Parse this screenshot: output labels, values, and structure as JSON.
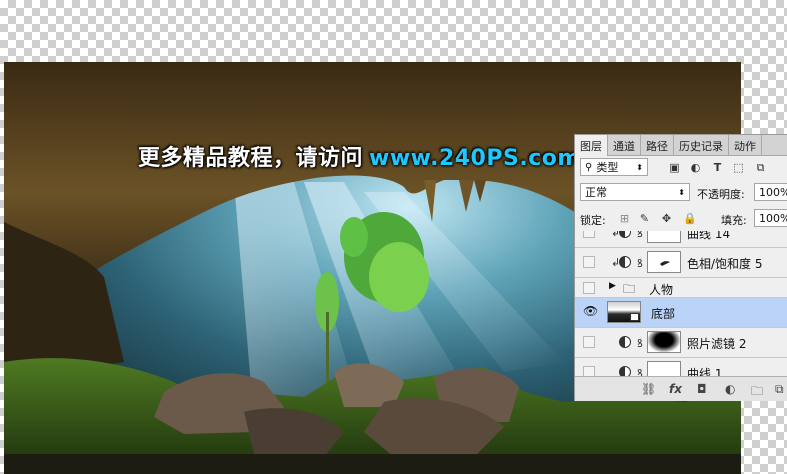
{
  "watermark": {
    "text_cn": "更多精品教程，请访问",
    "url": "www.240PS.com"
  },
  "panel": {
    "tabs": [
      "图层",
      "通道",
      "路径",
      "历史记录",
      "动作"
    ],
    "active_tab": "图层",
    "filter_label": "类型",
    "blend_mode": "正常",
    "opacity_label": "不透明度:",
    "opacity_value": "100%",
    "lock_label": "锁定:",
    "fill_label": "填充:",
    "fill_value": "100%",
    "layers": [
      {
        "name": "曲线 14",
        "visible": false,
        "type": "adjustment"
      },
      {
        "name": "色相/饱和度 5",
        "visible": false,
        "type": "adjustment"
      },
      {
        "name": "人物",
        "visible": false,
        "type": "group"
      },
      {
        "name": "底部",
        "visible": true,
        "type": "smart",
        "selected": true
      },
      {
        "name": "照片滤镜 2",
        "visible": false,
        "type": "adjustment"
      },
      {
        "name": "曲线 1",
        "visible": false,
        "type": "adjustment"
      }
    ]
  },
  "colors": {
    "watermark_url": "#1ec8ff",
    "selected_layer": "#bcd3f8"
  }
}
